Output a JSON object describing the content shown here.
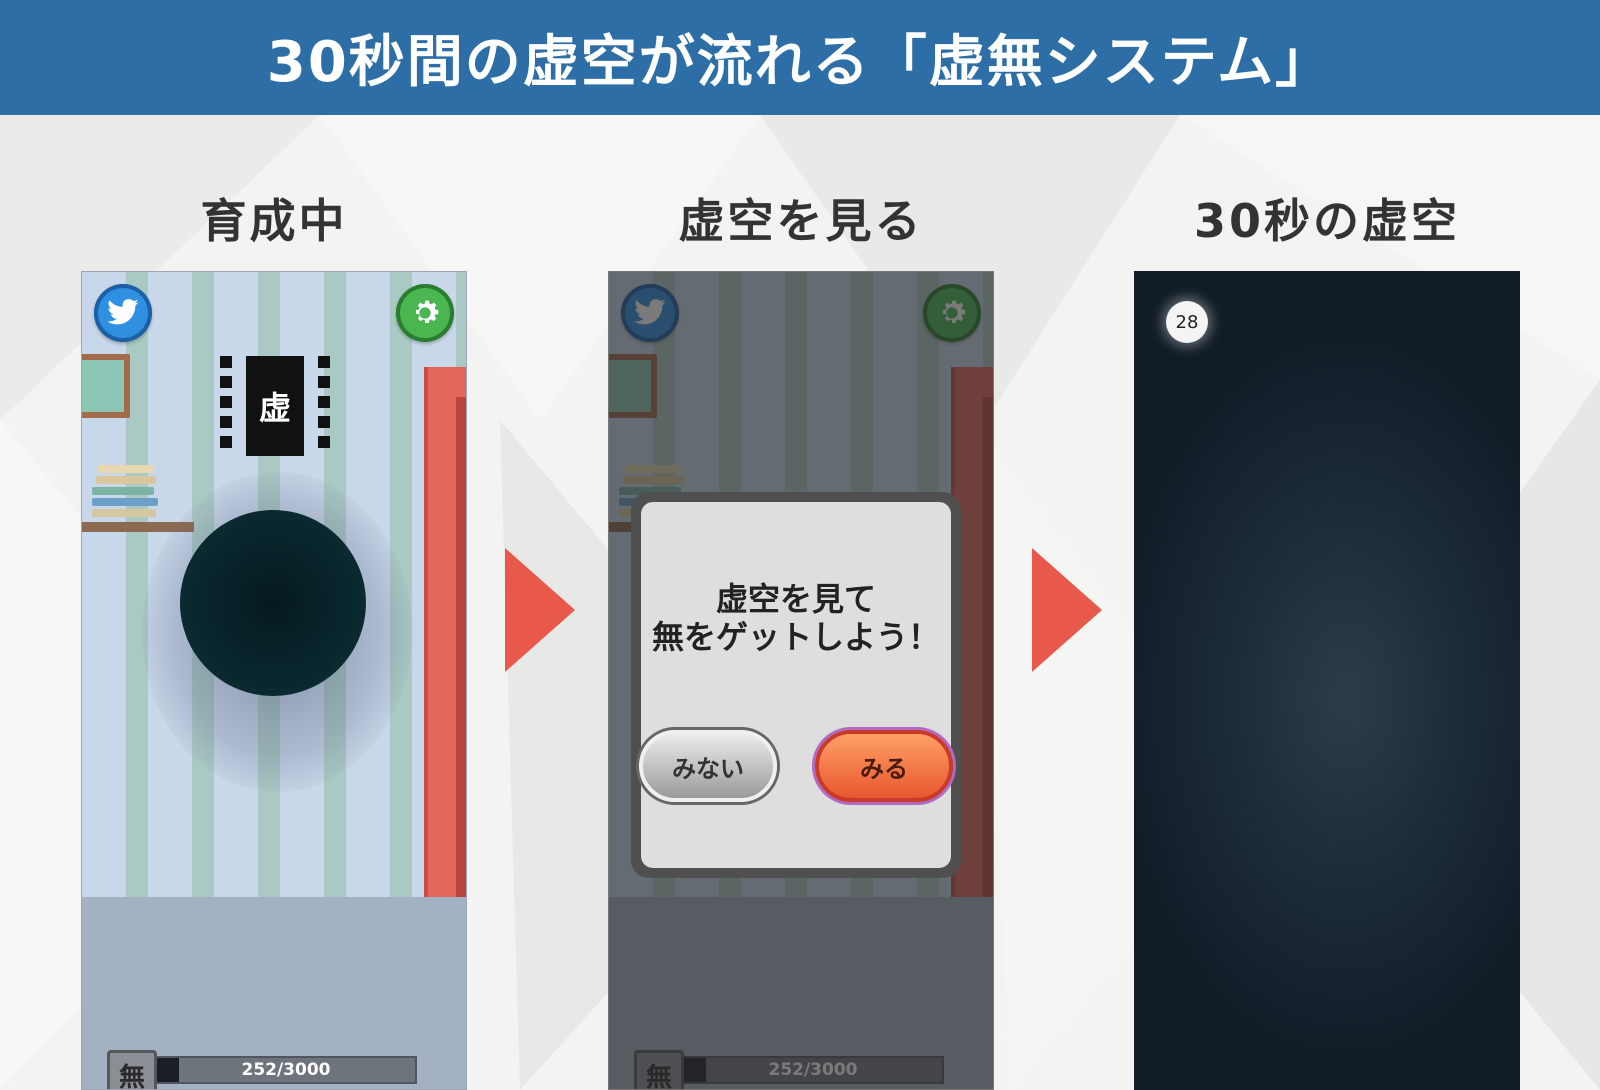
{
  "header": {
    "title": "30秒間の虚空が流れる「虚無システム」"
  },
  "columns": [
    {
      "title": "育成中"
    },
    {
      "title": "虚空を見る"
    },
    {
      "title": "30秒の虚空"
    }
  ],
  "game": {
    "board_label": "虚",
    "bar_icon_label": "無",
    "progress_text": "252/3000",
    "progress_current": 252,
    "progress_max": 3000,
    "twitter_icon": "twitter-bird-icon",
    "settings_icon": "gear-icon"
  },
  "dialog": {
    "message_line1": "虚空を見て",
    "message_line2": "無をゲットしよう！",
    "no_label": "みない",
    "yes_label": "みる"
  },
  "void_screen": {
    "timer": "28"
  },
  "colors": {
    "header": "#2e6ea6",
    "arrow": "#e8594b",
    "void": "#1c2a37"
  }
}
